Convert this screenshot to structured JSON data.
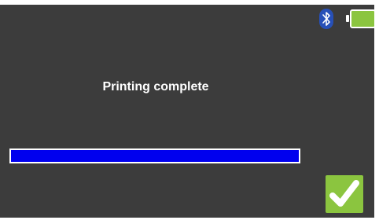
{
  "screen": {
    "background_color": "#3c3c3c"
  },
  "status_bar": {
    "bluetooth_icon": "bluetooth-icon",
    "battery_icon": "battery-icon",
    "battery_level": 1.0,
    "battery_color": "#8bc53f"
  },
  "dialog": {
    "message": "Printing complete",
    "progress": 1.0,
    "progress_color": "#0000ee"
  },
  "actions": {
    "confirm_icon": "checkmark-icon",
    "confirm_color": "#8bc53f"
  }
}
